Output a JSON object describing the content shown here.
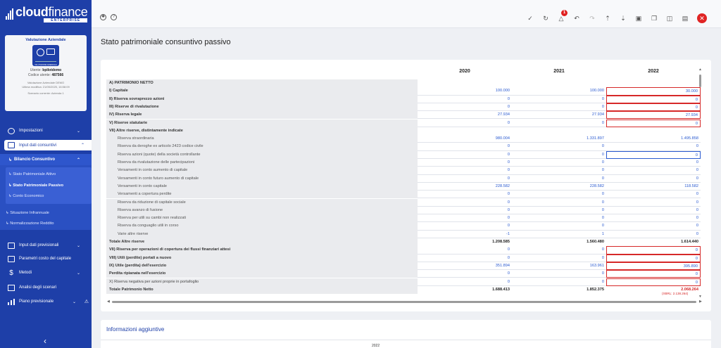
{
  "brand": {
    "name_bold": "cloud",
    "name_light": "finance",
    "edition": "ENTERPRISE"
  },
  "company_card": {
    "title": "Valutazione Aziendale",
    "image_caption": "VALUTAZIONE AZIENDALE",
    "user_label": "Utente:",
    "user": "bpilotdemo",
    "code_label": "Codice utente:",
    "code": "487566",
    "project": "Valutazione Aziendale DEMO",
    "modified": "Ultima modifica: 21/05/2025, 16:58:09",
    "scenario": "Scenario corrente: Azienda 1"
  },
  "nav": {
    "impostazioni": "Impostazioni",
    "input_consuntivi": "Input dati consuntivi",
    "bilancio_consuntivo": "Bilancio Consuntivo",
    "sp_attivo": "Stato Patrimoniale Attivo",
    "sp_passivo": "Stato Patrimoniale Passivo",
    "conto_economico": "Conto Economico",
    "situazione_infrannuale": "Situazione Infrannuale",
    "normalizzazione": "Normalizzazione Reddito",
    "input_previsionali": "Input dati previsionali",
    "parametri": "Parametri costo del capitale",
    "metodi": "Metodi",
    "analisi": "Analisi degli scenari",
    "piano": "Piano previsionale"
  },
  "toolbar": {
    "alert_count": "1"
  },
  "page": {
    "title": "Stato patrimoniale consuntivo passivo"
  },
  "sheet": {
    "years": [
      "2020",
      "2021",
      "2022"
    ],
    "rows": [
      {
        "label": "A) PATRIMONIO NETTO",
        "style": "b",
        "values": [
          "",
          "",
          ""
        ]
      },
      {
        "label": "I)  Capitale",
        "style": "b",
        "values": [
          "100.000",
          "100.000",
          "30.000"
        ]
      },
      {
        "label": "II)  Riserva sovraprezzo azioni",
        "style": "b",
        "values": [
          "0",
          "0",
          "0"
        ]
      },
      {
        "label": "III)  Riserve di rivalutazione",
        "style": "b",
        "values": [
          "0",
          "0",
          "0"
        ]
      },
      {
        "label": "IV)  Riserva legale",
        "style": "b",
        "values": [
          "27.934",
          "27.934",
          "27.934"
        ]
      },
      {
        "label": "V)  Riserve statutarie",
        "style": "b",
        "values": [
          "0",
          "0",
          "0"
        ]
      },
      {
        "label": "VII)  Altre riserve, distintamente indicate",
        "style": "b",
        "values": [
          "",
          "",
          ""
        ]
      },
      {
        "label": "Riserva straordinaria",
        "style": "ind",
        "values": [
          "980.004",
          "1.331.897",
          "1.495.858"
        ]
      },
      {
        "label": "Riserva da deroghe ex articolo 2423 codice civile",
        "style": "ind",
        "values": [
          "0",
          "0",
          "0"
        ]
      },
      {
        "label": "Riserva azioni (quote) della società controllante",
        "style": "ind",
        "values": [
          "0",
          "0",
          "0"
        ]
      },
      {
        "label": "Riserva da rivalutazione delle partecipazioni",
        "style": "ind",
        "values": [
          "0",
          "0",
          "0"
        ]
      },
      {
        "label": "Versamenti in conto aumento di capitale",
        "style": "ind",
        "values": [
          "0",
          "0",
          "0"
        ]
      },
      {
        "label": "Versamenti in conto futuro aumento di capitale",
        "style": "ind",
        "values": [
          "0",
          "0",
          "0"
        ]
      },
      {
        "label": "Versamenti in conto capitale",
        "style": "ind",
        "values": [
          "228.582",
          "228.582",
          "118.582"
        ]
      },
      {
        "label": "Versamenti a copertura perdite",
        "style": "ind",
        "values": [
          "0",
          "0",
          "0"
        ]
      },
      {
        "label": "Riserva da riduzione di capitale sociale",
        "style": "ind",
        "values": [
          "0",
          "0",
          "0"
        ]
      },
      {
        "label": "Riserva avanzo di fusione",
        "style": "ind",
        "values": [
          "0",
          "0",
          "0"
        ]
      },
      {
        "label": "Riserva per utili su cambi non realizzati",
        "style": "ind",
        "values": [
          "0",
          "0",
          "0"
        ]
      },
      {
        "label": "Riserva da conguaglio utili in corso",
        "style": "ind",
        "values": [
          "0",
          "0",
          "0"
        ]
      },
      {
        "label": "Varie altre riserve",
        "style": "ind",
        "values": [
          "-1",
          "1",
          "0"
        ]
      },
      {
        "label": "Totale Altre riserve",
        "style": "b",
        "values": [
          "1.208.585",
          "1.560.480",
          "1.614.440"
        ]
      },
      {
        "label": "VII)  Riserva per operazioni di copertura dei flussi finanziari attesi",
        "style": "b",
        "values": [
          "0",
          "0",
          "0"
        ]
      },
      {
        "label": "VIII)  Utili (perdite) portati a nuovo",
        "style": "b",
        "values": [
          "0",
          "0",
          "0"
        ]
      },
      {
        "label": "IX)  Utile (perdita) dell'esercizio",
        "style": "b",
        "values": [
          "351.894",
          "163.961",
          "395.890"
        ]
      },
      {
        "label": "Perdita ripianata nell'esercizio",
        "style": "b",
        "values": [
          "0",
          "0",
          "0"
        ]
      },
      {
        "label": "X)  Riserva negativa per azioni proprie in portafoglio",
        "style": "",
        "values": [
          "0",
          "0",
          "0"
        ]
      },
      {
        "label": "Totale Patrimonio Netto",
        "style": "b",
        "values": [
          "1.688.413",
          "1.852.375",
          "2.068.264"
        ]
      }
    ],
    "total_note": "(XBRL: 2.138.264)"
  },
  "info": {
    "title": "Informazioni aggiuntive",
    "year": "2022"
  }
}
